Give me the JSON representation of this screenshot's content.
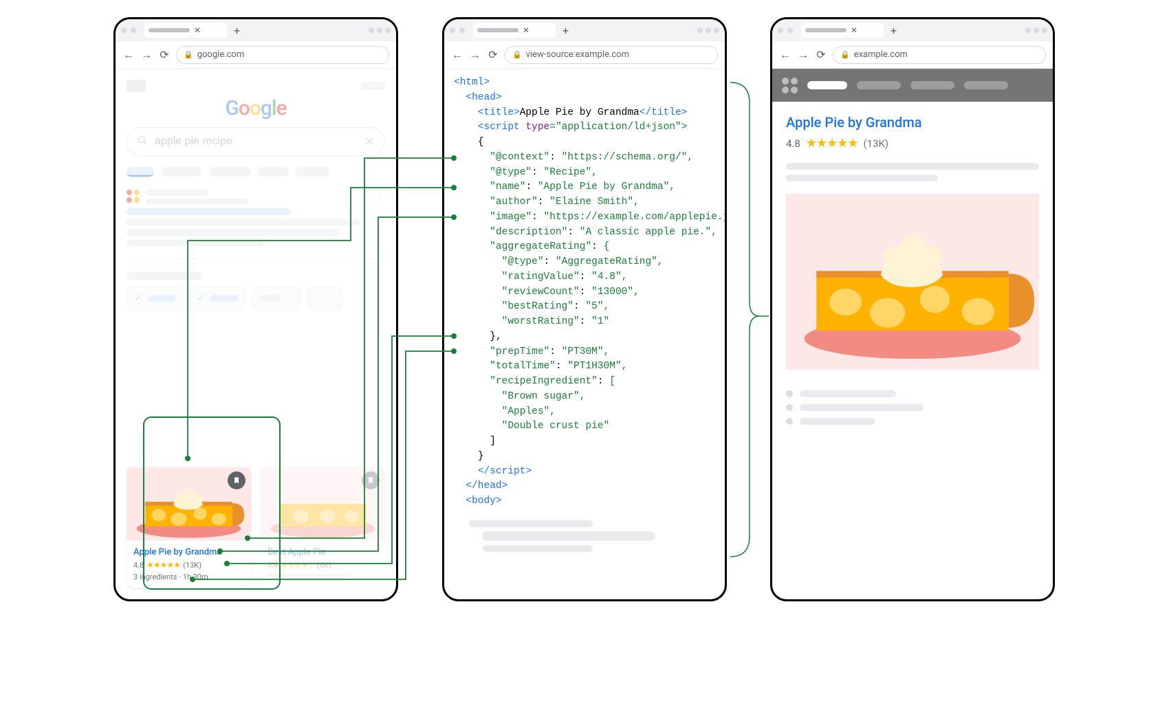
{
  "left": {
    "url": "google.com",
    "logo_letters": [
      "G",
      "o",
      "o",
      "g",
      "l",
      "e"
    ],
    "search_query": "apple pie recipe",
    "card": {
      "title": "Apple Pie by Grandma",
      "rating_value": "4.8",
      "review_short": "(13K)",
      "meta": "3 ingredients · 1h 30m"
    },
    "card2_title": "Best Apple Pie"
  },
  "middle": {
    "url": "view-source:example.com",
    "code": {
      "html_open": "<html>",
      "head_open": "<head>",
      "title_open": "<title>",
      "title_text": "Apple Pie by Grandma",
      "title_close": "</title>",
      "script_open_a": "<script ",
      "script_open_b": "type",
      "script_open_c": "=\"application/ld+json\">",
      "brace_open": "{",
      "kv": [
        {
          "k": "\"@context\"",
          "v": "\"https://schema.org/\","
        },
        {
          "k": "\"@type\"",
          "v": "\"Recipe\","
        },
        {
          "k": "\"name\"",
          "v": "\"Apple Pie by Grandma\","
        },
        {
          "k": "\"author\"",
          "v": "\"Elaine Smith\","
        },
        {
          "k": "\"image\"",
          "v": "\"https://example.com/applepie.jpg\","
        },
        {
          "k": "\"description\"",
          "v": "\"A classic apple pie.\","
        },
        {
          "k": "\"aggregateRating\"",
          "v": "{"
        },
        {
          "k": "\"@type\"",
          "v": "\"AggregateRating\",",
          "indent": 1
        },
        {
          "k": "\"ratingValue\"",
          "v": "\"4.8\",",
          "indent": 1
        },
        {
          "k": "\"reviewCount\"",
          "v": "\"13000\",",
          "indent": 1
        },
        {
          "k": "\"bestRating\"",
          "v": "\"5\",",
          "indent": 1
        },
        {
          "k": "\"worstRating\"",
          "v": "\"1\"",
          "indent": 1
        }
      ],
      "agg_close": "},",
      "kv2": [
        {
          "k": "\"prepTime\"",
          "v": "\"PT30M\","
        },
        {
          "k": "\"totalTime\"",
          "v": "\"PT1H30M\","
        },
        {
          "k": "\"recipeIngredient\"",
          "v": "["
        }
      ],
      "ingredients": [
        "\"Brown sugar\",",
        "\"Apples\",",
        "\"Double crust pie\""
      ],
      "arr_close": "]",
      "brace_close": "}",
      "script_close": "</script>",
      "head_close": "</head>",
      "body_open": "<body>"
    }
  },
  "right": {
    "url": "example.com",
    "title": "Apple Pie by Grandma",
    "rating_value": "4.8",
    "stars": "★★★★★",
    "review_short": "(13K)"
  }
}
